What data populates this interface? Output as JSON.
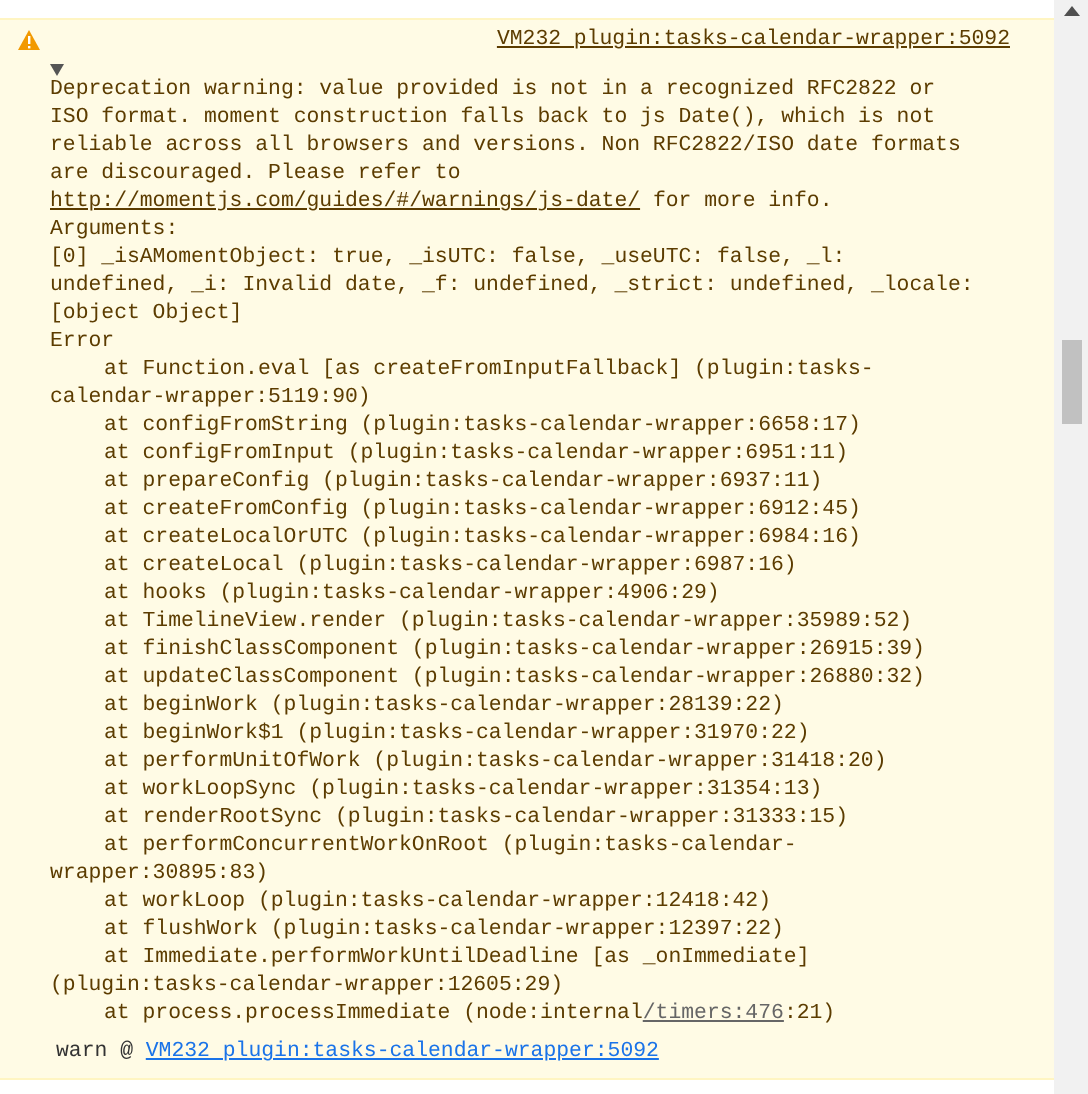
{
  "console_entry": {
    "kind": "warning",
    "expanded": true,
    "message_start": "Deprecation warning: value provided is not in a recognized RFC2822 or ISO format. moment construction falls back to js Date(), which is not reliable across all browsers and versions. Non RFC2822/ISO date formats are discouraged. Please refer to",
    "message_link": "http://momentjs.com/guides/#/warnings/js-date/",
    "message_end": "for more info.",
    "source_link": "VM232 plugin:tasks-calendar-wrapper:5092",
    "arguments_label": "Arguments:",
    "arguments": "[0] _isAMomentObject: true, _isUTC: false, _useUTC: false, _l: undefined, _i: Invalid date, _f: undefined, _strict: undefined, _locale: [object Object]",
    "error_label": "Error",
    "stack": [
      {
        "text": "at Function.eval [as createFromInputFallback] (plugin:tasks-calendar-wrapper:5119:90)"
      },
      {
        "text": "at configFromString (plugin:tasks-calendar-wrapper:6658:17)"
      },
      {
        "text": "at configFromInput (plugin:tasks-calendar-wrapper:6951:11)"
      },
      {
        "text": "at prepareConfig (plugin:tasks-calendar-wrapper:6937:11)"
      },
      {
        "text": "at createFromConfig (plugin:tasks-calendar-wrapper:6912:45)"
      },
      {
        "text": "at createLocalOrUTC (plugin:tasks-calendar-wrapper:6984:16)"
      },
      {
        "text": "at createLocal (plugin:tasks-calendar-wrapper:6987:16)"
      },
      {
        "text": "at hooks (plugin:tasks-calendar-wrapper:4906:29)"
      },
      {
        "text": "at TimelineView.render (plugin:tasks-calendar-wrapper:35989:52)"
      },
      {
        "text": "at finishClassComponent (plugin:tasks-calendar-wrapper:26915:39)"
      },
      {
        "text": "at updateClassComponent (plugin:tasks-calendar-wrapper:26880:32)"
      },
      {
        "text": "at beginWork (plugin:tasks-calendar-wrapper:28139:22)"
      },
      {
        "text": "at beginWork$1 (plugin:tasks-calendar-wrapper:31970:22)"
      },
      {
        "text": "at performUnitOfWork (plugin:tasks-calendar-wrapper:31418:20)"
      },
      {
        "text": "at workLoopSync (plugin:tasks-calendar-wrapper:31354:13)"
      },
      {
        "text": "at renderRootSync (plugin:tasks-calendar-wrapper:31333:15)"
      },
      {
        "text": "at performConcurrentWorkOnRoot (plugin:tasks-calendar-wrapper:30895:83)"
      },
      {
        "text": "at workLoop (plugin:tasks-calendar-wrapper:12418:42)"
      },
      {
        "text": "at flushWork (plugin:tasks-calendar-wrapper:12397:22)"
      },
      {
        "text": "at Immediate.performWorkUntilDeadline [as _onImmediate] (plugin:tasks-calendar-wrapper:12605:29)"
      },
      {
        "text": "at process.processImmediate (node:internal",
        "link": "/timers:476",
        "after": ":21)"
      }
    ],
    "footer_label": "warn @",
    "footer_link": "VM232 plugin:tasks-calendar-wrapper:5092"
  }
}
